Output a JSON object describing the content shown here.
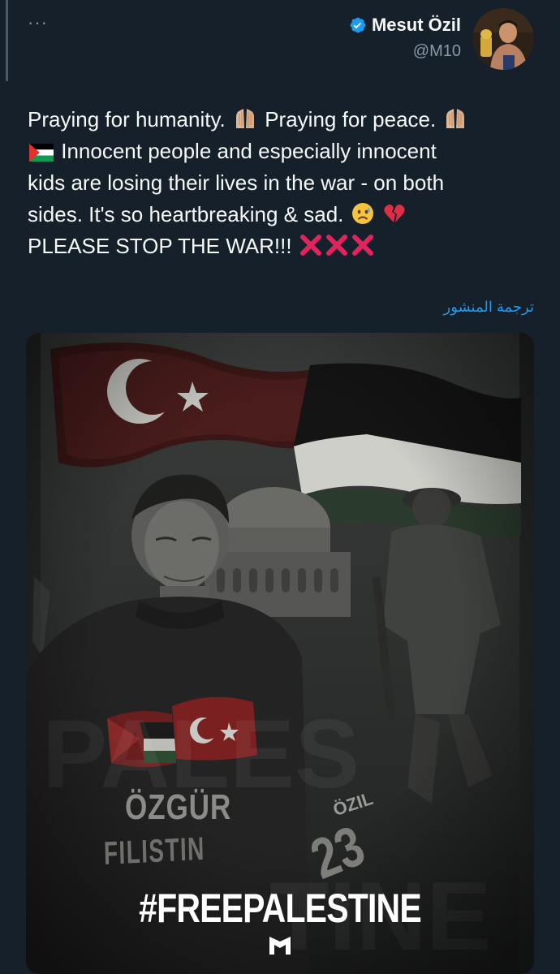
{
  "more_icon": "more-horizontal-icon",
  "author": {
    "display_name": "Mesut Özil",
    "handle": "@M10",
    "verified_icon": "verified-badge-icon",
    "verified_color": "#1d9bf0"
  },
  "tweet": {
    "line1": "Praying for humanity.",
    "line1b": "Praying for peace.",
    "line2": "Innocent people and especially innocent",
    "line3": "kids are losing their lives in the war - on both",
    "line4": "sides. It's so heartbreaking & sad.",
    "line5": "PLEASE STOP THE WAR!!!",
    "emojis": [
      "praying-hands-icon",
      "palestine-flag-icon",
      "sad-face-icon",
      "broken-heart-icon",
      "cross-mark-icon"
    ]
  },
  "translate_label": "ترجمة المنشور",
  "media": {
    "hashtag": "#FREEPALESTINE",
    "banner_line1": "ÖZGÜR",
    "banner_line2": "FILISTIN",
    "shirt_name": "ÖZIL",
    "shirt_number": "23"
  },
  "colors": {
    "background": "#15202b",
    "text": "#f7f9f9",
    "muted": "#8b98a5",
    "link": "#1d9bf0",
    "cross": "#e0245e"
  }
}
